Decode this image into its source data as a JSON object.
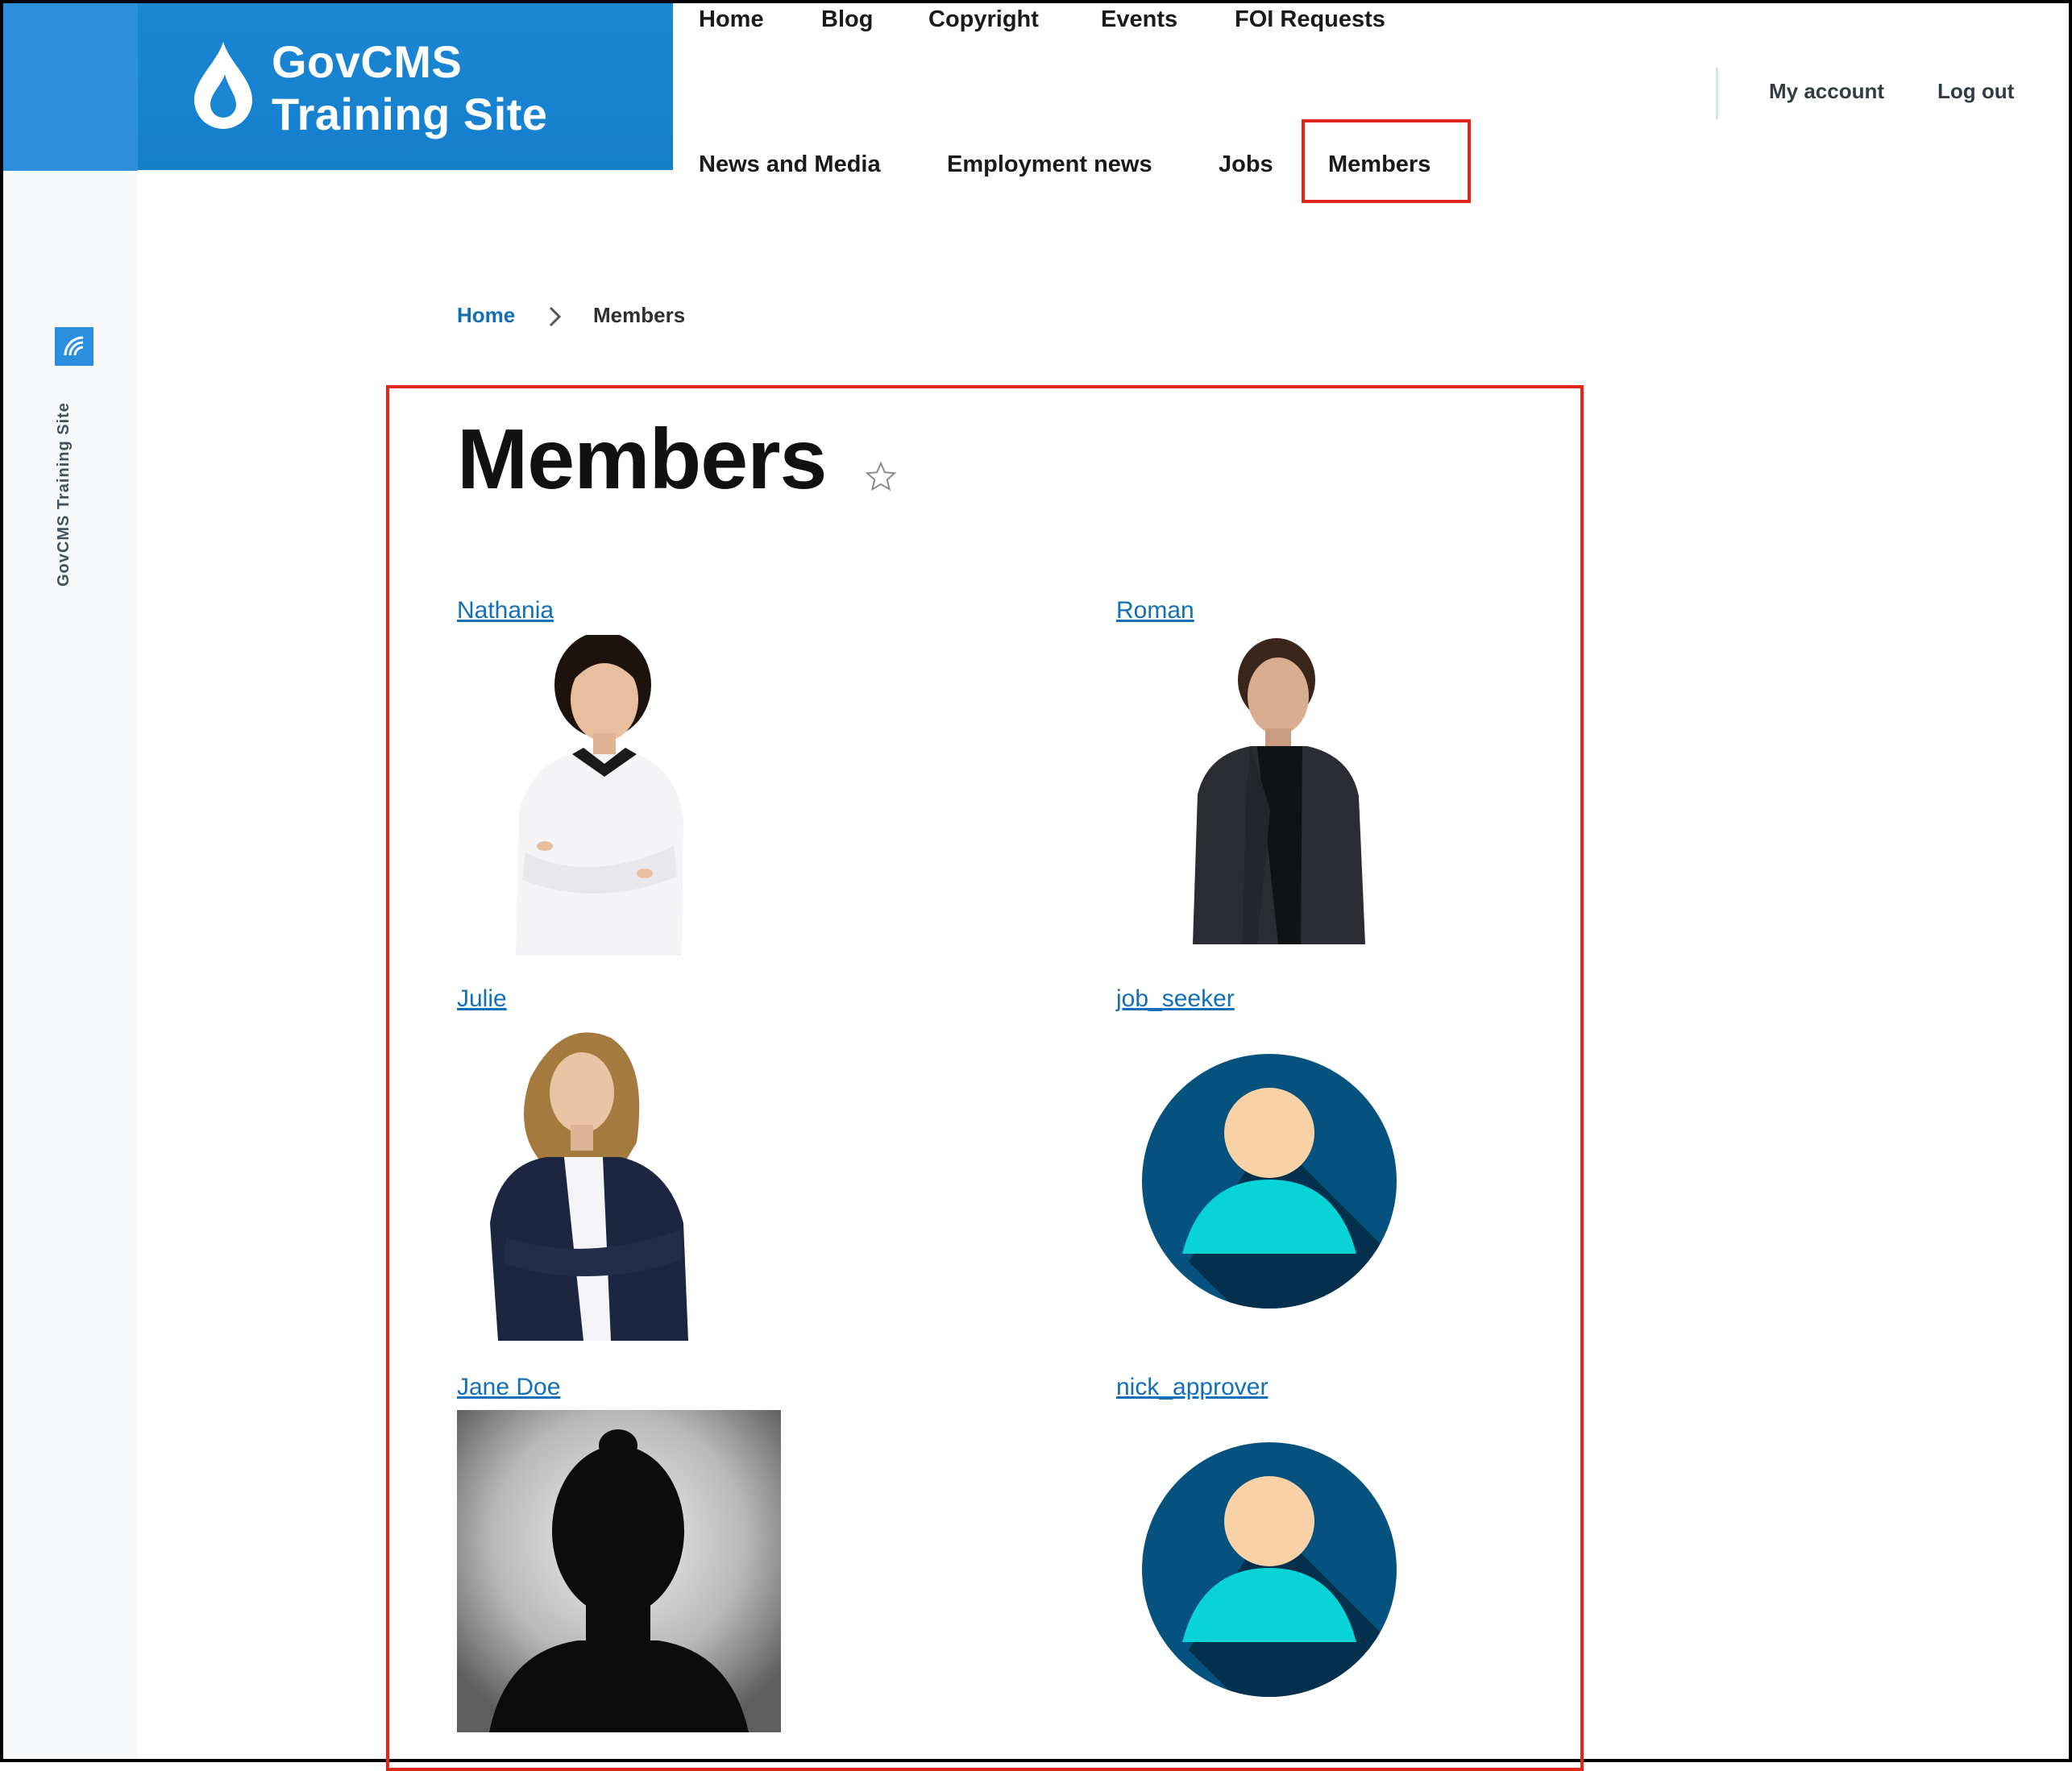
{
  "site": {
    "title_line1": "GovCMS",
    "title_line2": "Training Site",
    "sidebar_label": "GovCMS Training Site",
    "brand_color": "#1a86d4"
  },
  "nav": {
    "row1": [
      "Home",
      "Blog",
      "Copyright",
      "Events",
      "FOI Requests"
    ],
    "row2": [
      "News and Media",
      "Employment news",
      "Jobs",
      "Members"
    ],
    "active": "Members",
    "highlight_color": "#e3261b"
  },
  "user_menu": {
    "my_account": "My account",
    "log_out": "Log out"
  },
  "breadcrumb": {
    "home": "Home",
    "current": "Members"
  },
  "page": {
    "title": "Members"
  },
  "members": [
    {
      "name": "Nathania",
      "picture": "photo-woman-white-blouse"
    },
    {
      "name": "Roman",
      "picture": "photo-man-dark-blazer"
    },
    {
      "name": "Julie",
      "picture": "photo-woman-navy-blazer"
    },
    {
      "name": "job_seeker",
      "picture": "default-avatar-icon"
    },
    {
      "name": "Jane Doe",
      "picture": "silhouette-photo"
    },
    {
      "name": "nick_approver",
      "picture": "default-avatar-icon"
    }
  ]
}
